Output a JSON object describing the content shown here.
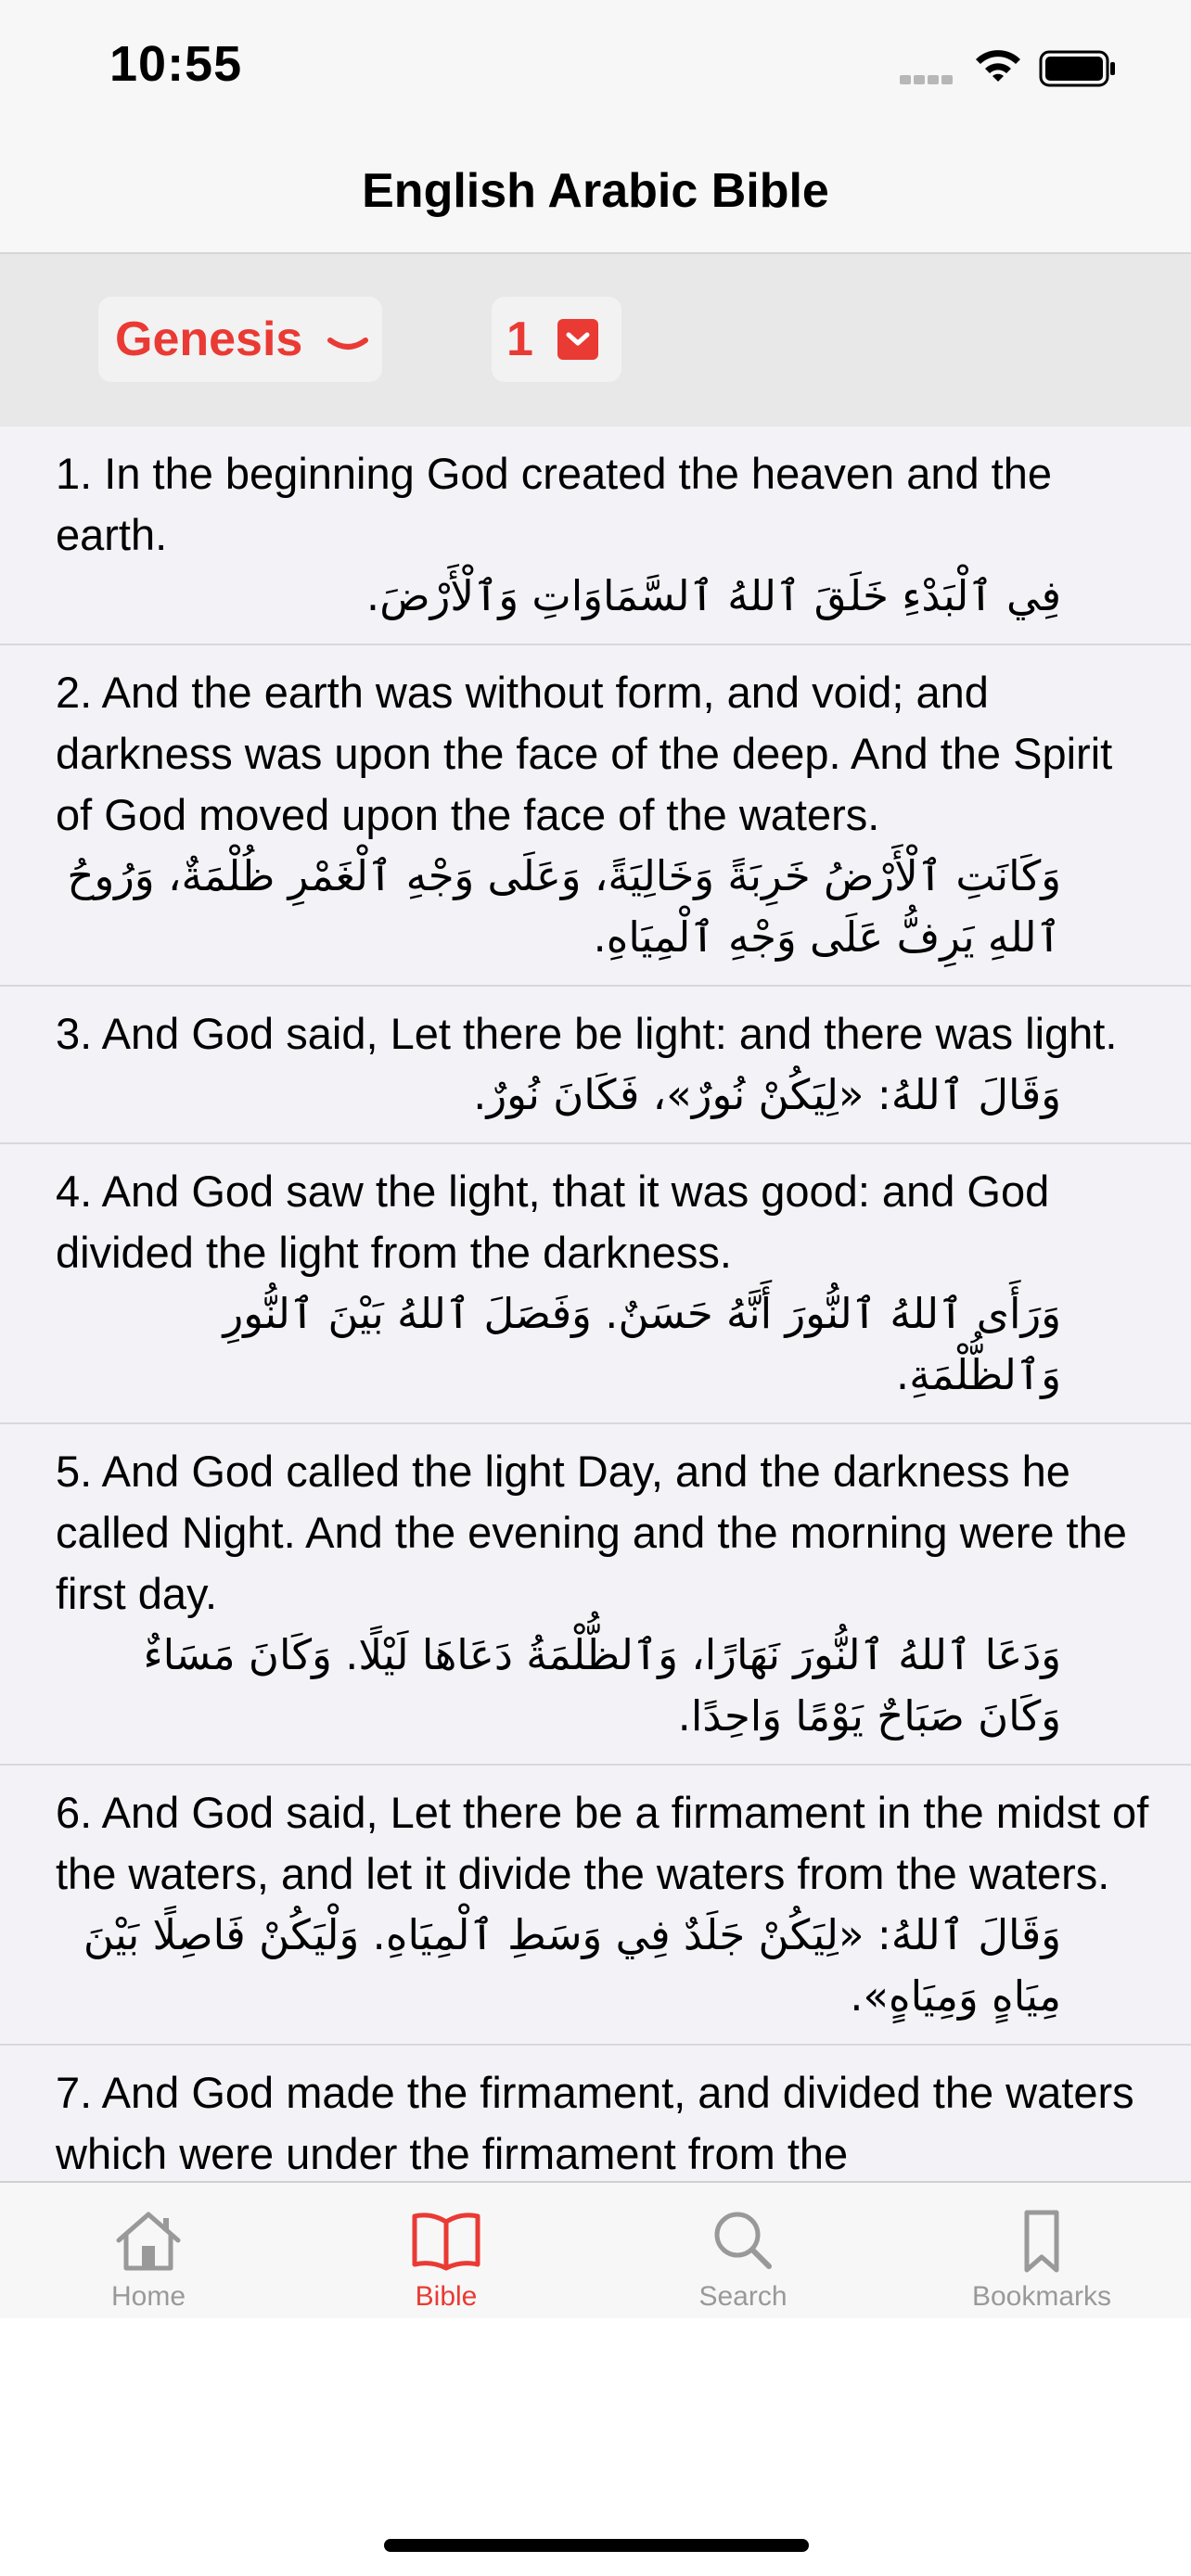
{
  "status_bar": {
    "time": "10:55"
  },
  "nav": {
    "title": "English Arabic Bible"
  },
  "pickers": {
    "book": "Genesis",
    "chapter": "1"
  },
  "verses": [
    {
      "en": "1. In the beginning God created the heaven and the earth.",
      "ar": "فِي ٱلْبَدْءِ خَلَقَ ٱللهُ ٱلسَّمَاوَاتِ وَٱلْأَرْضَ."
    },
    {
      "en": "2. And the earth was without form, and void; and darkness was upon the face of the deep. And the Spirit of God moved upon the face of the waters.",
      "ar": "وَكَانَتِ ٱلْأَرْضُ خَرِبَةً وَخَالِيَةً، وَعَلَى وَجْهِ ٱلْغَمْرِ ظُلْمَةٌ، وَرُوحُ ٱللهِ يَرِفُّ عَلَى وَجْهِ ٱلْمِيَاهِ."
    },
    {
      "en": "3. And God said, Let there be light: and there was light.",
      "ar": "وَقَالَ ٱللهُ: «لِيَكُنْ نُورٌ»، فَكَانَ نُورٌ."
    },
    {
      "en": "4. And God saw the light, that it was good: and God divided the light from the darkness.",
      "ar": "وَرَأَى ٱللهُ ٱلنُّورَ أَنَّهُ حَسَنٌ. وَفَصَلَ ٱللهُ بَيْنَ ٱلنُّورِ وَٱلظُّلْمَةِ."
    },
    {
      "en": "5. And God called the light Day, and the darkness he called Night. And the evening and the morning were the first day.",
      "ar": "وَدَعَا ٱللهُ ٱلنُّورَ نَهَارًا، وَٱلظُّلْمَةُ دَعَاهَا لَيْلًا. وَكَانَ مَسَاءٌ وَكَانَ صَبَاحٌ يَوْمًا وَاحِدًا."
    },
    {
      "en": "6. And God said, Let there be a firmament in the midst of the waters, and let it divide the waters from the waters.",
      "ar": "وَقَالَ ٱللهُ: «لِيَكُنْ جَلَدٌ فِي وَسَطِ ٱلْمِيَاهِ. وَلْيَكُنْ فَاصِلًا بَيْنَ مِيَاهٍ وَمِيَاهٍ»."
    },
    {
      "en": "7. And God made the firmament, and divided the waters which were under the firmament from the",
      "ar": ""
    }
  ],
  "tabs": [
    {
      "label": "Home",
      "icon": "house-icon",
      "active": false
    },
    {
      "label": "Bible",
      "icon": "open-book-icon",
      "active": true
    },
    {
      "label": "Search",
      "icon": "magnifying-glass-icon",
      "active": false
    },
    {
      "label": "Bookmarks",
      "icon": "bookmark-icon",
      "active": false
    }
  ],
  "colors": {
    "accent": "#ea3a34",
    "inactive": "#999999",
    "background": "#f2f2f7"
  }
}
